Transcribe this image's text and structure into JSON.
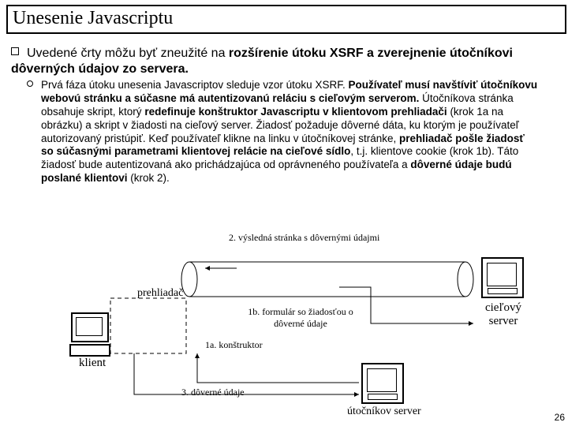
{
  "title": "Unesenie Javascriptu",
  "bullet1_html": "Uvedené črty môžu byť zneužité na <b>rozšírenie útoku XSRF a zverejnenie útočníkovi dôverných údajov zo servera.</b>",
  "bullet2_html": "Prvá fáza útoku unesenia Javascriptov sleduje vzor útoku XSRF. <b>Používateľ musí navštíviť útočníkovu webovú stránku a súčasne má autentizovanú reláciu s cieľovým serverom.</b> Útočníkova stránka obsahuje skript, ktorý <b>redefinuje konštruktor Javascriptu v klientovom prehliadači</b> (krok 1a na obrázku) a skript v žiadosti na cieľový server. Žiadosť požaduje dôverné dáta, ku ktorým je používateľ autorizovaný pristúpiť. Keď používateľ klikne na linku v útočníkovej stránke, <b>prehliadač pošle žiadosť so súčasnými parametrami klientovej relácie na cieľové sídlo</b>, t.j. klientove cookie (krok 1b). Táto žiadosť bude autentizovaná ako prichádzajúca od oprávneného používateľa a <b>dôverné údaje budú poslané klientovi</b> (krok 2).",
  "labels": {
    "prehliadac": "prehliadač",
    "klient": "klient",
    "cielovy_server": "cieľový\nserver",
    "utocnikov_server": "útočníkov server",
    "step2": "2. výsledná stránka s dôvernými údajmi",
    "step1b": "1b. formulár so žiadosťou o\ndôverné údaje",
    "step1a": "1a. konštruktor",
    "step3": "3. dôverné údaje"
  },
  "page_number": "26"
}
